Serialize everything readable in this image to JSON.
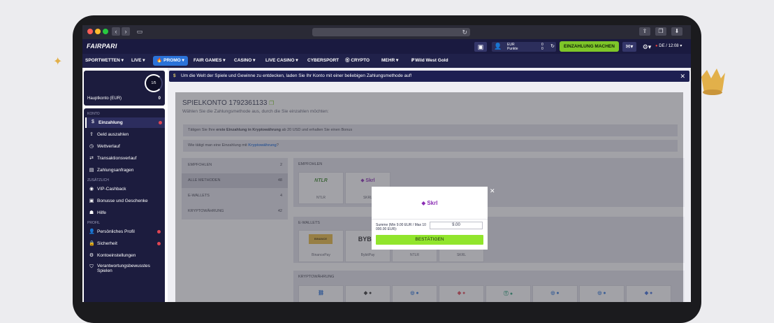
{
  "browser": {
    "icons": [
      "share-icon",
      "tabs-icon",
      "download-icon"
    ]
  },
  "topbar": {
    "logo": "FAIRPARI",
    "account": {
      "currency": "EUR",
      "points_label": "Punkte",
      "balance": "0",
      "points": "0"
    },
    "deposit_button": "EINZAHLUNG MACHEN",
    "language": "DE / 12:08"
  },
  "nav": {
    "items": [
      {
        "label": "SPORTWETTEN ▾"
      },
      {
        "label": "LIVE ▾"
      },
      {
        "label": "PROMO ▾"
      },
      {
        "label": "FAIR GAMES ▾"
      },
      {
        "label": "CASINO ▾"
      },
      {
        "label": "LIVE CASINO ▾"
      },
      {
        "label": "CYBERSPORT"
      },
      {
        "label": "CRYPTO"
      },
      {
        "label": "MEHR ▾"
      },
      {
        "label": "Wild West Gold"
      }
    ]
  },
  "sidebar": {
    "progress": "1/5",
    "main_account_label": "Hauptkonto (EUR)",
    "main_account_value": "0",
    "sections": {
      "konto": "KONTO",
      "zusaetzlich": "ZUSÄTZLICH",
      "profil": "PROFIL"
    },
    "items": [
      {
        "label": "Einzahlung"
      },
      {
        "label": "Geld auszahlen"
      },
      {
        "label": "Wettverlauf"
      },
      {
        "label": "Transaktionsverlauf"
      },
      {
        "label": "Zahlungsanfragen"
      },
      {
        "label": "VIP-Cashback"
      },
      {
        "label": "Bonusse und Geschenke"
      },
      {
        "label": "Hilfe"
      },
      {
        "label": "Persönliches Profil"
      },
      {
        "label": "Sicherheit"
      },
      {
        "label": "Kontoeinstellungen"
      },
      {
        "label": "Verantwortungsbewusstes Spielen"
      }
    ]
  },
  "banner": {
    "text": "Um die Welt der Spiele und Gewinne zu entdecken, laden Sie Ihr Konto mit einer beliebigen Zahlungsmethode auf!"
  },
  "main": {
    "title": "SPIELKONTO 1792361133",
    "subtitle": "Wählen Sie die Zahlungsmethode aus, durch die Sie einzahlen möchten:",
    "info1": {
      "pre": "Tätigen Sie Ihre ",
      "bold": "erste Einzahlung in Kryptowährung",
      "post": " ab 20 USD und erhalten Sie einen Bonus"
    },
    "info2": {
      "pre": "Wie tätigt man eine Einzahlung mit ",
      "link": "Kryptowährung",
      "post": "?"
    },
    "methods": [
      {
        "name": "EMPFOHLEN",
        "count": "2"
      },
      {
        "name": "ALLE METHODEN",
        "count": "48"
      },
      {
        "name": "E-WALLETS",
        "count": "4"
      },
      {
        "name": "KRYPTOWÄHRUNG",
        "count": "42"
      }
    ],
    "sections": {
      "recommended": "EMPFOHLEN",
      "ewallets": "E-WALLETS",
      "crypto": "KRYPTOWÄHRUNG"
    },
    "recommended_cards": [
      {
        "logo": "NTLR",
        "label": "NTLR"
      },
      {
        "logo": "Skrl",
        "label": "SKRL"
      }
    ],
    "ewallet_cards": [
      {
        "logo": "BINANCE",
        "label": "BinancePay"
      },
      {
        "logo": "BYB!T",
        "label": "BybitPay"
      },
      {
        "logo": "",
        "label": "NTLR"
      },
      {
        "logo": "",
        "label": "SKRL"
      }
    ]
  },
  "modal": {
    "logo": "Skrl",
    "amount_label": "Summe (Min 9.00 EUR / Max 10 000.00 EUR):",
    "amount_value": "9.00",
    "confirm_button": "BESTÄTIGEN"
  },
  "colors": {
    "accent_green": "#7ec629",
    "modal_button": "#91e52c",
    "topbar_bg": "#1a1a40",
    "promo_blue": "#2b73d9",
    "skrill_purple": "#8b2db4"
  }
}
